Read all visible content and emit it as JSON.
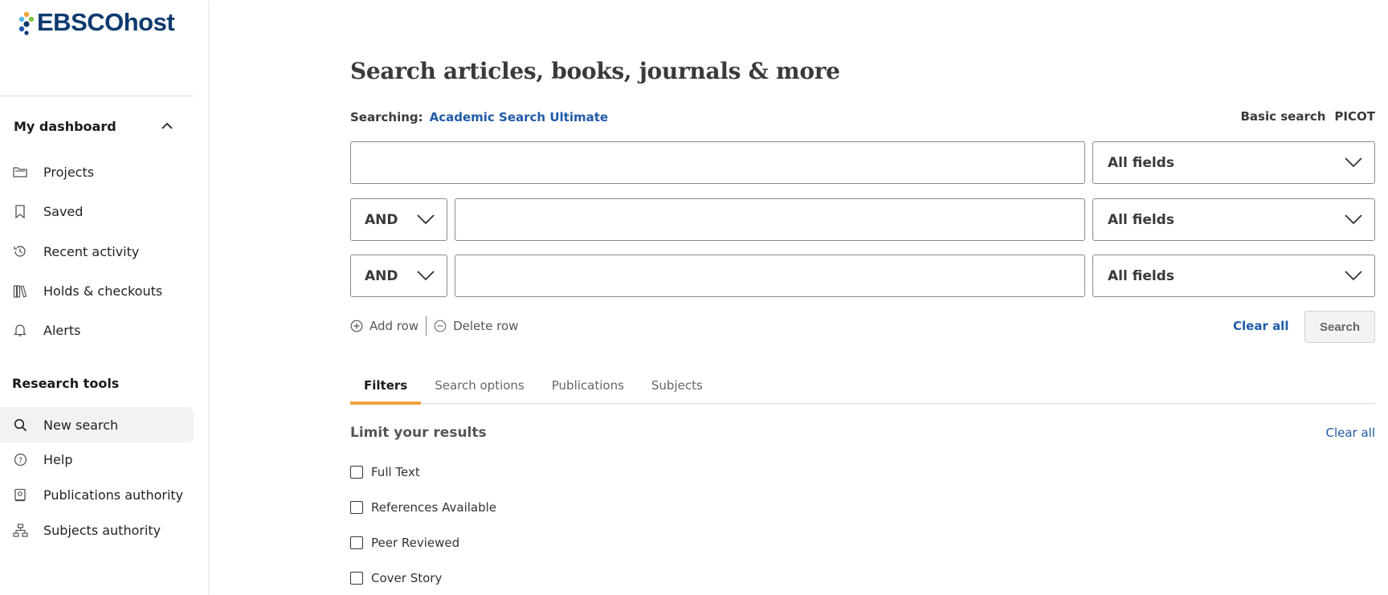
{
  "brand": {
    "name": "EBSCOhost",
    "color": "#0d3a6e"
  },
  "sidebar": {
    "dashboard_title": "My dashboard",
    "dashboard_items": [
      {
        "label": "Projects",
        "icon": "folder-icon"
      },
      {
        "label": "Saved",
        "icon": "bookmark-icon"
      },
      {
        "label": "Recent activity",
        "icon": "history-icon"
      },
      {
        "label": "Holds & checkouts",
        "icon": "books-icon"
      },
      {
        "label": "Alerts",
        "icon": "bell-icon"
      }
    ],
    "research_title": "Research tools",
    "research_items": [
      {
        "label": "New search",
        "icon": "search-icon",
        "active": true
      },
      {
        "label": "Help",
        "icon": "help-icon"
      },
      {
        "label": "Publications authority",
        "icon": "publication-icon"
      },
      {
        "label": "Subjects authority",
        "icon": "hierarchy-icon"
      }
    ]
  },
  "main": {
    "title": "Search articles, books, journals & more",
    "searching_label": "Searching:",
    "database": "Academic Search Ultimate",
    "modes": [
      "Basic search",
      "PICOT"
    ],
    "rows": [
      {
        "boolean": null,
        "value": "",
        "field": "All fields"
      },
      {
        "boolean": "AND",
        "value": "",
        "field": "All fields"
      },
      {
        "boolean": "AND",
        "value": "",
        "field": "All fields"
      }
    ],
    "add_row": "Add row",
    "delete_row": "Delete row",
    "clear_all": "Clear all",
    "search_button": "Search",
    "tabs": [
      "Filters",
      "Search options",
      "Publications",
      "Subjects"
    ],
    "active_tab": "Filters",
    "limit_title": "Limit your results",
    "limit_clear_all": "Clear all",
    "limiters": [
      {
        "label": "Full Text",
        "checked": false
      },
      {
        "label": "References Available",
        "checked": false
      },
      {
        "label": "Peer Reviewed",
        "checked": false
      },
      {
        "label": "Cover Story",
        "checked": false
      }
    ]
  },
  "colors": {
    "link": "#1f5ba8",
    "tab_accent": "#f2a33a",
    "active_item_bg": "#f2f2f2"
  }
}
